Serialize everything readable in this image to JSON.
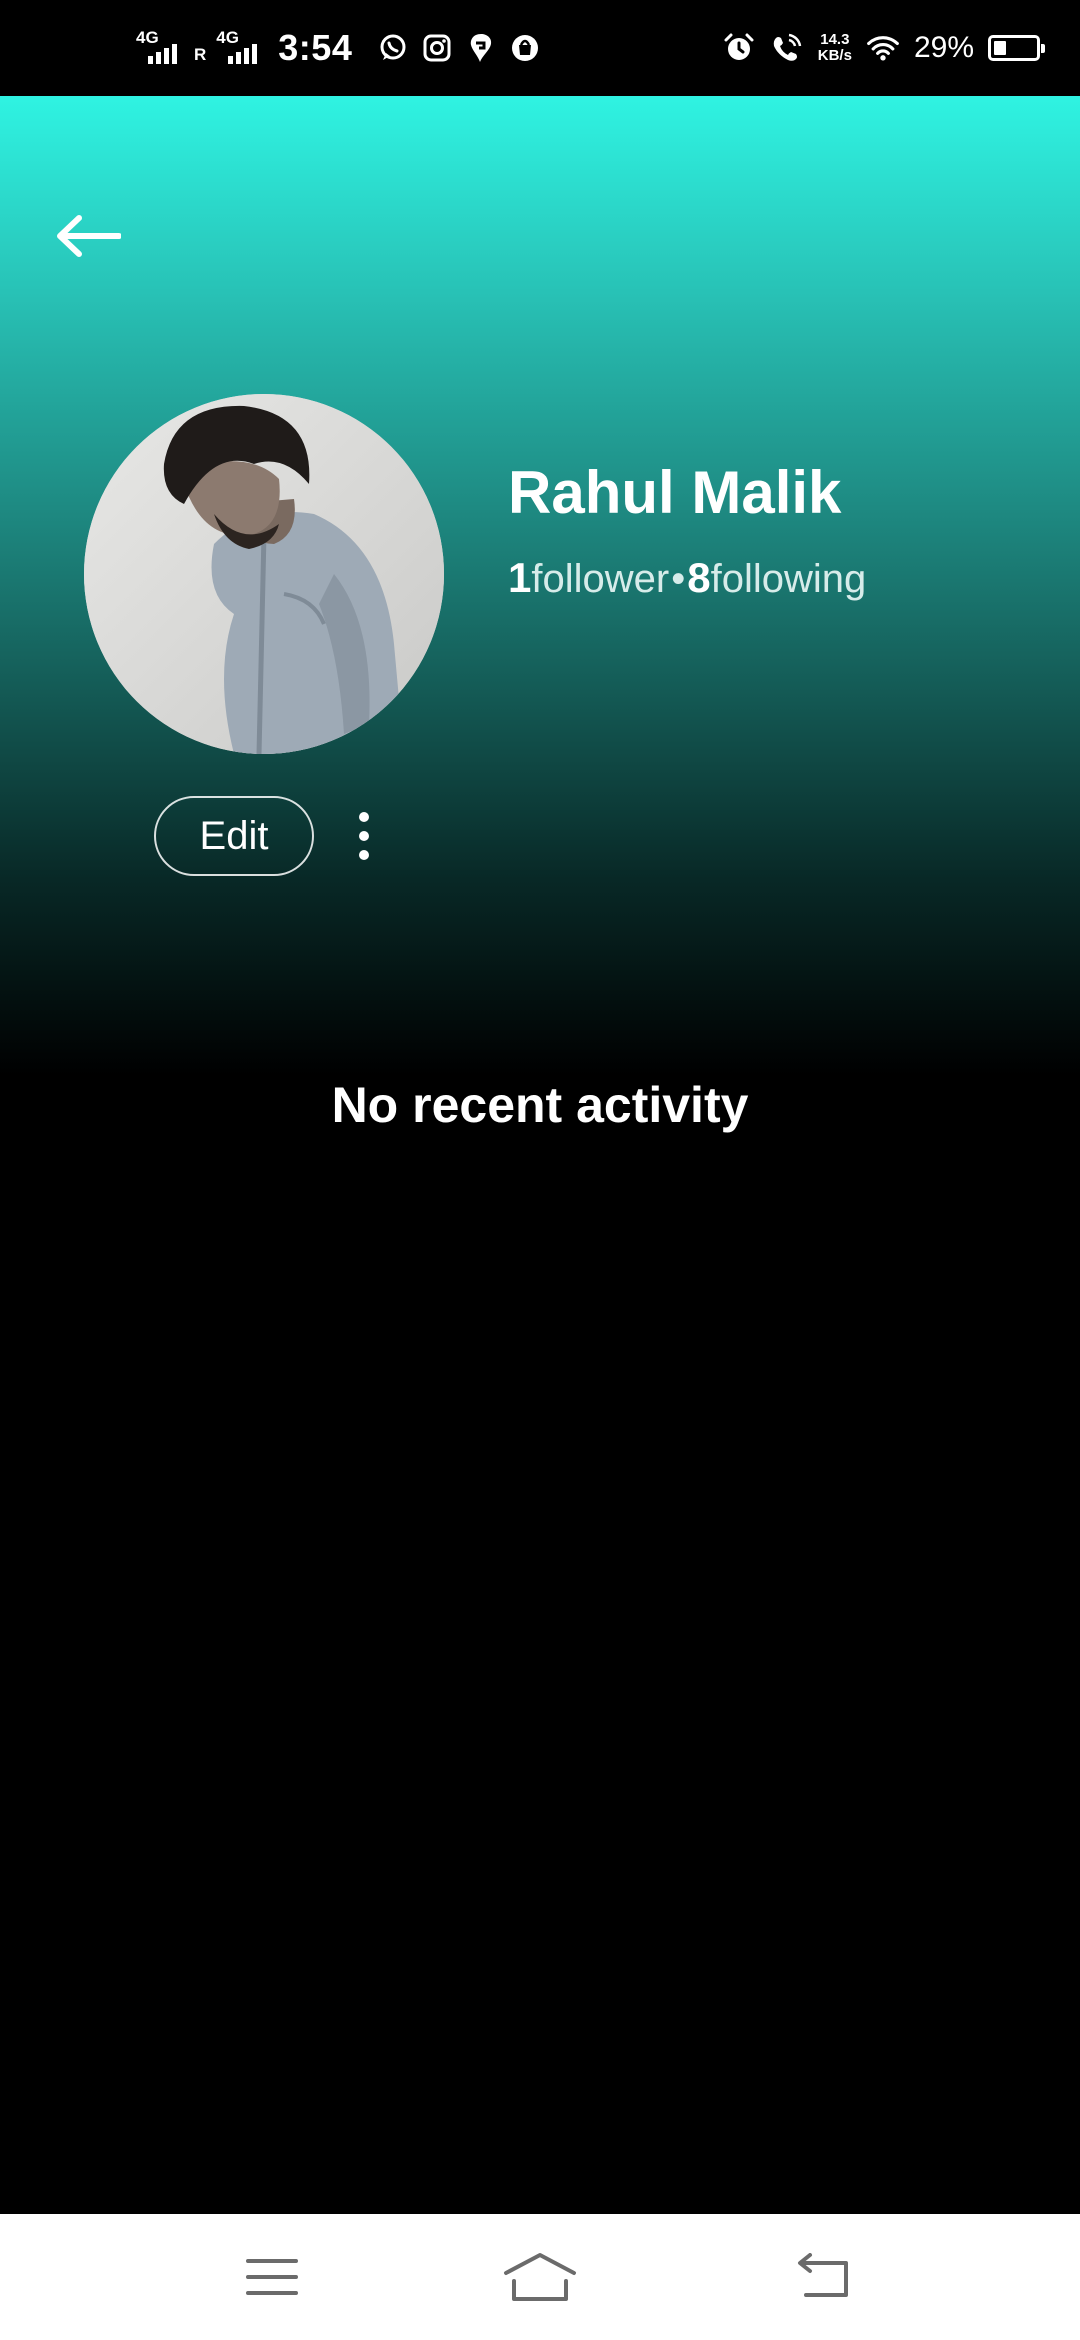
{
  "status_bar": {
    "net1_label": "4G",
    "roaming_label": "R",
    "net2_label": "4G",
    "time": "3:54",
    "apps": [
      "whatsapp-icon",
      "instagram-icon",
      "swiggy-icon",
      "shopping-bag-icon"
    ],
    "speed_value": "14.3",
    "speed_unit": "KB/s",
    "battery_percent": "29%",
    "battery_level": 0.29
  },
  "header": {
    "back_icon": "arrow-left-icon"
  },
  "profile": {
    "name": "Rahul Malik",
    "followers_count": "1",
    "followers_label": "follower",
    "separator": "•",
    "following_count": "8",
    "following_label": "following",
    "edit_label": "Edit",
    "more_icon": "more-vertical-icon"
  },
  "activity": {
    "empty_message": "No recent activity"
  },
  "colors": {
    "gradient_top": "#2ff3e2",
    "gradient_bottom": "#000000",
    "background": "#000000"
  },
  "nav": {
    "icons": [
      "menu-icon",
      "home-icon",
      "back-icon"
    ]
  }
}
